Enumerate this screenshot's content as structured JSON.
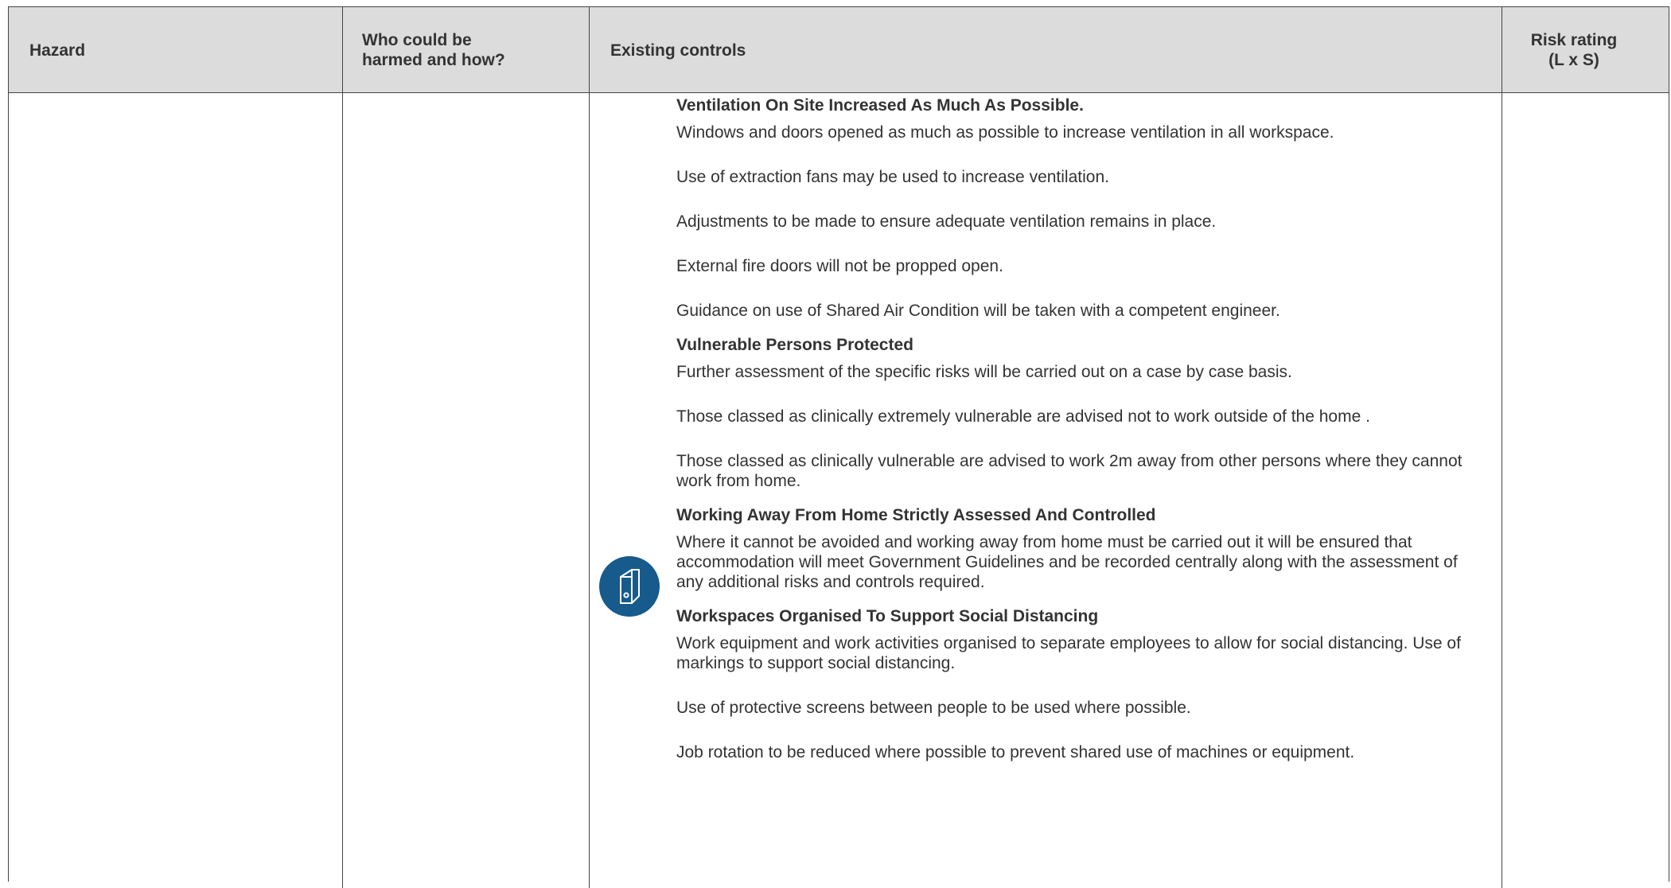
{
  "table": {
    "headers": {
      "hazard": "Hazard",
      "who_line1": "Who could be",
      "who_line2": "harmed and how?",
      "controls": "Existing controls",
      "risk_line1": "Risk rating",
      "risk_line2": "(L x S)"
    },
    "sections": [
      {
        "title": "Ventilation On Site Increased As Much As Possible.",
        "paragraphs": [
          "Windows and doors opened as much as possible to increase ventilation in all workspace.",
          "Use of extraction fans may be used to increase ventilation.",
          "Adjustments to be made to ensure adequate ventilation remains in place.",
          "External fire doors will not be propped open.",
          "Guidance on use of Shared Air Condition will be taken with a competent engineer."
        ]
      },
      {
        "title": "Vulnerable Persons Protected",
        "paragraphs": [
          "Further assessment of the specific risks will be carried out on a case by case basis.",
          "Those classed as clinically extremely vulnerable are advised not to work outside of the home .",
          "Those classed as clinically vulnerable are advised to work 2m away from other persons where they cannot work from home."
        ]
      },
      {
        "title": "Working Away From Home Strictly Assessed And Controlled",
        "paragraphs": [
          "Where it cannot be avoided and working away from home must be carried out it will be ensured that accommodation will meet Government Guidelines and be recorded centrally along with the assessment of any additional risks and controls required."
        ]
      },
      {
        "title": "Workspaces Organised To Support Social Distancing",
        "paragraphs": [
          "Work equipment and work activities organised to separate employees to allow for social distancing. Use of markings to support social distancing.",
          "Use of protective screens between people to be used where possible.",
          "Job rotation to be reduced where possible to prevent shared use of machines or equipment."
        ]
      }
    ]
  },
  "icons": {
    "binder": "binder-icon"
  },
  "colors": {
    "header_bg": "#dcdcdc",
    "icon_bg": "#175a8c",
    "text": "#333333",
    "border": "#444444"
  }
}
